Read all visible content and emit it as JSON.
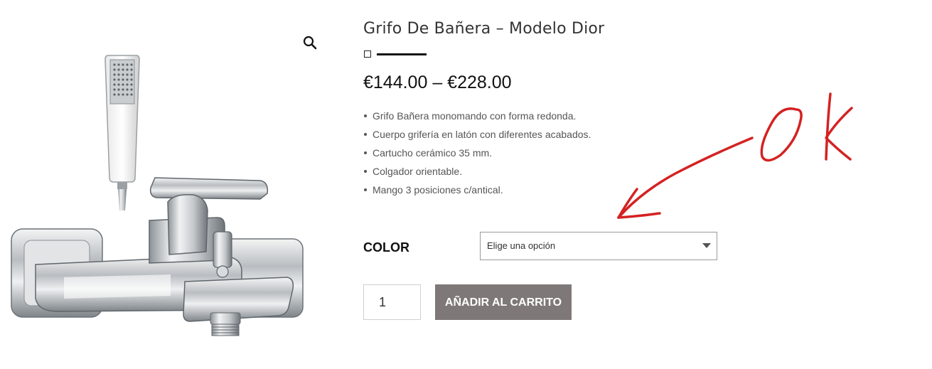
{
  "product": {
    "title": "Grifo De Bañera – Modelo Dior",
    "price": "€144.00 – €228.00",
    "features": [
      "Grifo Bañera monomando con forma redonda.",
      "Cuerpo grifería en latón con diferentes acabados.",
      "Cartucho cerámico 35 mm.",
      "Colgador orientable.",
      "Mango 3 posiciones c/antical."
    ]
  },
  "variation": {
    "label": "COLOR",
    "selected": "Elige una opción"
  },
  "cart": {
    "quantity": "1",
    "add_label": "AÑADIR AL CARRITO"
  },
  "icons": {
    "zoom": "magnifier-icon",
    "select_arrow": "caret-down-icon"
  },
  "colors": {
    "button_bg": "#7f7879",
    "annotation": "#d42222"
  }
}
